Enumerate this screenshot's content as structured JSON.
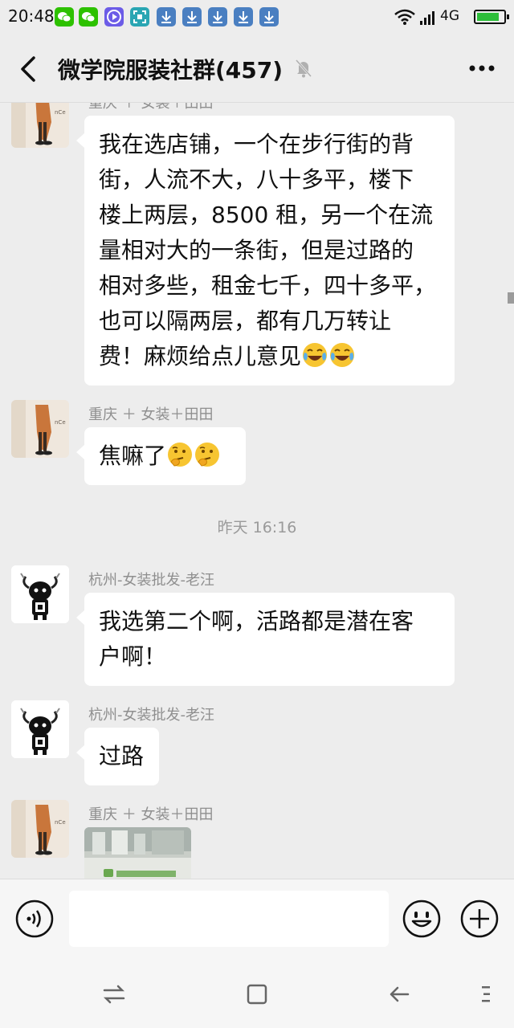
{
  "status_bar": {
    "time": "20:48",
    "network": "4G",
    "battery_level": 0.85,
    "notification_icons": [
      "wechat-icon",
      "wechat-icon",
      "video-icon",
      "scan-icon",
      "download-icon",
      "download-icon",
      "download-icon",
      "download-icon",
      "download-icon"
    ]
  },
  "header": {
    "title": "微学院服装社群(457)",
    "muted_icon": "bell-off-icon",
    "back_icon": "chevron-left-icon",
    "more_icon": "more-icon"
  },
  "messages": [
    {
      "sender": "重庆 ＋ 女装＋田田",
      "avatar": "person-avatar",
      "text_lines": [
        "我在选店铺，一个在步行街的背",
        "街，人流不大，八十多平，楼下",
        "楼上两层，8500 租，另一个在流",
        "量相对大的一条街，但是过路的",
        "相对多些，租金七千，四十多平，",
        "也可以隔两层，都有几万转让",
        "费！麻烦给点儿意见"
      ],
      "emojis": [
        "tears-of-joy-emoji",
        "tears-of-joy-emoji"
      ]
    },
    {
      "sender": "重庆 ＋ 女装＋田田",
      "avatar": "person-avatar",
      "text": "焦嘛了",
      "emojis": [
        "thinking-emoji",
        "thinking-emoji"
      ]
    },
    {
      "timestamp": "昨天 16:16"
    },
    {
      "sender": "杭州-女装批发-老汪",
      "avatar": "bull-avatar",
      "text_lines": [
        "我选第二个啊，活路都是潜在客",
        "户啊！"
      ]
    },
    {
      "sender": "杭州-女装批发-老汪",
      "avatar": "bull-avatar",
      "text": "过路"
    },
    {
      "sender": "重庆 ＋ 女装＋田田",
      "avatar": "person-avatar",
      "attachment": "image-thumbnail"
    }
  ],
  "input_bar": {
    "placeholder": "",
    "voice_icon": "voice-icon",
    "emoji_icon": "emoji-icon",
    "plus_icon": "plus-icon"
  },
  "system_nav": [
    "menu-switch-icon",
    "home-square-icon",
    "back-arrow-icon",
    "more-vertical-icon"
  ],
  "colors": {
    "background": "#ededed",
    "bubble": "#ffffff",
    "sender_text": "#8f8f8f",
    "wechat_green": "#2dc100"
  }
}
